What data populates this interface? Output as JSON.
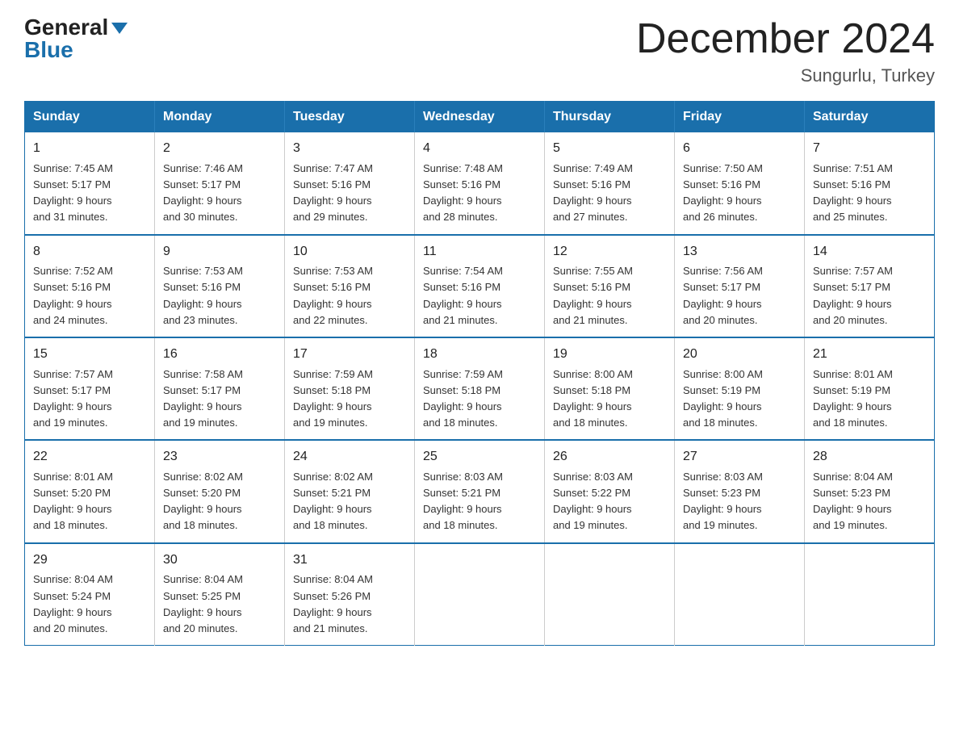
{
  "header": {
    "logo_general": "General",
    "logo_blue": "Blue",
    "month_title": "December 2024",
    "location": "Sungurlu, Turkey"
  },
  "days_of_week": [
    "Sunday",
    "Monday",
    "Tuesday",
    "Wednesday",
    "Thursday",
    "Friday",
    "Saturday"
  ],
  "weeks": [
    [
      {
        "day": "1",
        "sunrise": "7:45 AM",
        "sunset": "5:17 PM",
        "daylight": "9 hours and 31 minutes."
      },
      {
        "day": "2",
        "sunrise": "7:46 AM",
        "sunset": "5:17 PM",
        "daylight": "9 hours and 30 minutes."
      },
      {
        "day": "3",
        "sunrise": "7:47 AM",
        "sunset": "5:16 PM",
        "daylight": "9 hours and 29 minutes."
      },
      {
        "day": "4",
        "sunrise": "7:48 AM",
        "sunset": "5:16 PM",
        "daylight": "9 hours and 28 minutes."
      },
      {
        "day": "5",
        "sunrise": "7:49 AM",
        "sunset": "5:16 PM",
        "daylight": "9 hours and 27 minutes."
      },
      {
        "day": "6",
        "sunrise": "7:50 AM",
        "sunset": "5:16 PM",
        "daylight": "9 hours and 26 minutes."
      },
      {
        "day": "7",
        "sunrise": "7:51 AM",
        "sunset": "5:16 PM",
        "daylight": "9 hours and 25 minutes."
      }
    ],
    [
      {
        "day": "8",
        "sunrise": "7:52 AM",
        "sunset": "5:16 PM",
        "daylight": "9 hours and 24 minutes."
      },
      {
        "day": "9",
        "sunrise": "7:53 AM",
        "sunset": "5:16 PM",
        "daylight": "9 hours and 23 minutes."
      },
      {
        "day": "10",
        "sunrise": "7:53 AM",
        "sunset": "5:16 PM",
        "daylight": "9 hours and 22 minutes."
      },
      {
        "day": "11",
        "sunrise": "7:54 AM",
        "sunset": "5:16 PM",
        "daylight": "9 hours and 21 minutes."
      },
      {
        "day": "12",
        "sunrise": "7:55 AM",
        "sunset": "5:16 PM",
        "daylight": "9 hours and 21 minutes."
      },
      {
        "day": "13",
        "sunrise": "7:56 AM",
        "sunset": "5:17 PM",
        "daylight": "9 hours and 20 minutes."
      },
      {
        "day": "14",
        "sunrise": "7:57 AM",
        "sunset": "5:17 PM",
        "daylight": "9 hours and 20 minutes."
      }
    ],
    [
      {
        "day": "15",
        "sunrise": "7:57 AM",
        "sunset": "5:17 PM",
        "daylight": "9 hours and 19 minutes."
      },
      {
        "day": "16",
        "sunrise": "7:58 AM",
        "sunset": "5:17 PM",
        "daylight": "9 hours and 19 minutes."
      },
      {
        "day": "17",
        "sunrise": "7:59 AM",
        "sunset": "5:18 PM",
        "daylight": "9 hours and 19 minutes."
      },
      {
        "day": "18",
        "sunrise": "7:59 AM",
        "sunset": "5:18 PM",
        "daylight": "9 hours and 18 minutes."
      },
      {
        "day": "19",
        "sunrise": "8:00 AM",
        "sunset": "5:18 PM",
        "daylight": "9 hours and 18 minutes."
      },
      {
        "day": "20",
        "sunrise": "8:00 AM",
        "sunset": "5:19 PM",
        "daylight": "9 hours and 18 minutes."
      },
      {
        "day": "21",
        "sunrise": "8:01 AM",
        "sunset": "5:19 PM",
        "daylight": "9 hours and 18 minutes."
      }
    ],
    [
      {
        "day": "22",
        "sunrise": "8:01 AM",
        "sunset": "5:20 PM",
        "daylight": "9 hours and 18 minutes."
      },
      {
        "day": "23",
        "sunrise": "8:02 AM",
        "sunset": "5:20 PM",
        "daylight": "9 hours and 18 minutes."
      },
      {
        "day": "24",
        "sunrise": "8:02 AM",
        "sunset": "5:21 PM",
        "daylight": "9 hours and 18 minutes."
      },
      {
        "day": "25",
        "sunrise": "8:03 AM",
        "sunset": "5:21 PM",
        "daylight": "9 hours and 18 minutes."
      },
      {
        "day": "26",
        "sunrise": "8:03 AM",
        "sunset": "5:22 PM",
        "daylight": "9 hours and 19 minutes."
      },
      {
        "day": "27",
        "sunrise": "8:03 AM",
        "sunset": "5:23 PM",
        "daylight": "9 hours and 19 minutes."
      },
      {
        "day": "28",
        "sunrise": "8:04 AM",
        "sunset": "5:23 PM",
        "daylight": "9 hours and 19 minutes."
      }
    ],
    [
      {
        "day": "29",
        "sunrise": "8:04 AM",
        "sunset": "5:24 PM",
        "daylight": "9 hours and 20 minutes."
      },
      {
        "day": "30",
        "sunrise": "8:04 AM",
        "sunset": "5:25 PM",
        "daylight": "9 hours and 20 minutes."
      },
      {
        "day": "31",
        "sunrise": "8:04 AM",
        "sunset": "5:26 PM",
        "daylight": "9 hours and 21 minutes."
      },
      null,
      null,
      null,
      null
    ]
  ],
  "labels": {
    "sunrise_prefix": "Sunrise: ",
    "sunset_prefix": "Sunset: ",
    "daylight_prefix": "Daylight: "
  }
}
